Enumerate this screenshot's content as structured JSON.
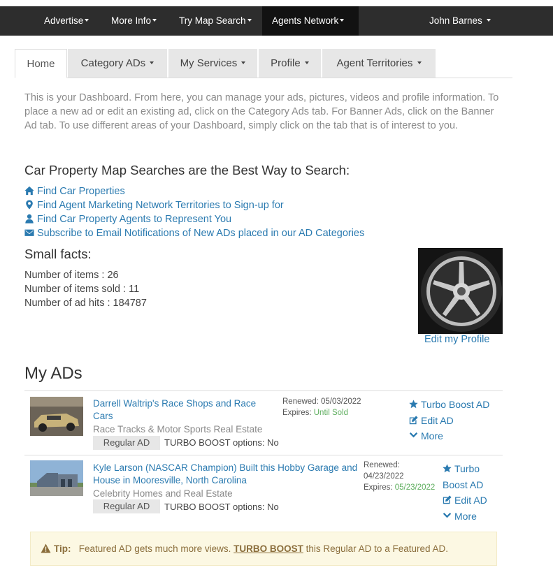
{
  "topnav": {
    "items": [
      {
        "label": "Advertise"
      },
      {
        "label": "More Info"
      },
      {
        "label": "Try Map Search"
      },
      {
        "label": "Agents Network"
      }
    ],
    "user": "John Barnes"
  },
  "tabs": [
    "Home",
    "Category ADs",
    "My Services",
    "Profile",
    "Agent Territories"
  ],
  "intro": "This is your Dashboard. From here, you can manage your ads, pictures, videos and profile information. To place a new ad or edit an existing ad, click on the Category Ads tab. For Banner Ads, click on the Banner Ad tab. To use different areas of your Dashboard, simply click on the tab that is of interest to you.",
  "search_heading": "Car Property Map Searches are the Best Way to Search:",
  "links": [
    {
      "label": "Find Car Properties",
      "icon": "home-icon"
    },
    {
      "label": "Find Agent Marketing Network Territories to Sign-up for",
      "icon": "map-marker-icon"
    },
    {
      "label": "Find Car Property Agents to Represent You",
      "icon": "user-icon"
    },
    {
      "label": "Subscribe to Email Notifications of New ADs placed in our AD Categories",
      "icon": "envelope-icon"
    }
  ],
  "facts": {
    "heading": "Small facts:",
    "items": "Number of items : 26",
    "sold": "Number of items sold : 11",
    "hits": "Number of ad hits : 184787"
  },
  "edit_profile": "Edit my Profile",
  "ads_heading": "My ADs",
  "ads": [
    {
      "title": "Darrell Waltrip's Race Shops and Race Cars",
      "category": "Race Tracks & Motor Sports Real Estate",
      "type": "Regular AD",
      "turbo_options": "TURBO BOOST options: No",
      "renewed": "Renewed: 05/03/2022",
      "expires_label": "Expires: ",
      "expires_value": "Until Sold",
      "actions": [
        "Turbo Boost AD",
        "Edit AD",
        "More"
      ]
    },
    {
      "title": "Kyle Larson (NASCAR Champion) Built this Hobby Garage and House in Mooresville, North Carolina",
      "category": "Celebrity Homes and Real Estate",
      "type": "Regular AD",
      "turbo_options": "TURBO BOOST options: No",
      "renewed_label": "Renewed:",
      "renewed_date": "04/23/2022",
      "expires_label": "Expires: ",
      "expires_value": "05/23/2022",
      "actions": [
        "Turbo",
        "Boost AD",
        "Edit AD",
        "More"
      ]
    }
  ],
  "tip": {
    "label": "Tip:",
    "text_before": "Featured AD gets much more views.",
    "link": "TURBO BOOST",
    "text_after": "this Regular AD to a Featured AD."
  },
  "colors": {
    "navbar": "#2d2d2d",
    "link": "#2a7ab0",
    "green": "#5fae5f",
    "tip_bg": "#fcf8e3"
  }
}
